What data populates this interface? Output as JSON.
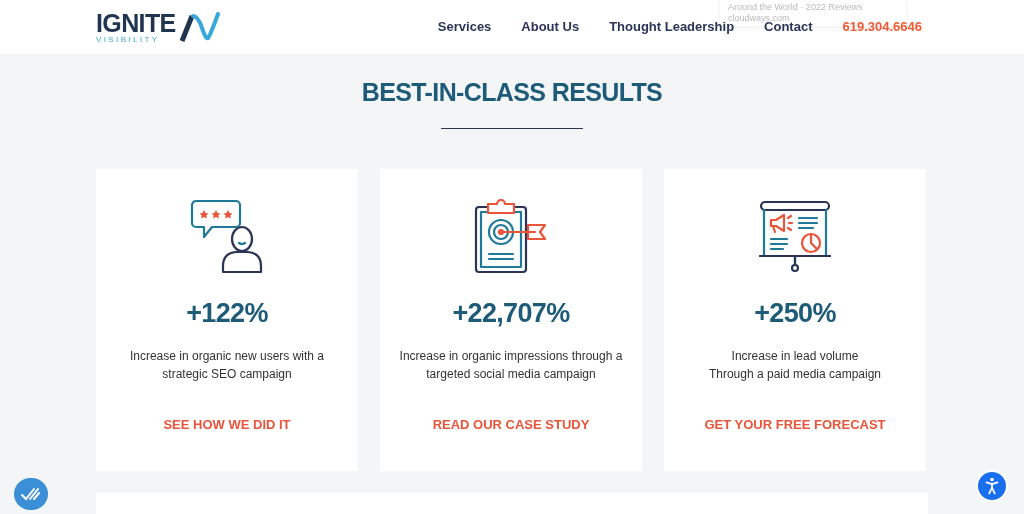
{
  "header": {
    "logo": {
      "word": "IGNITE",
      "subword": "VISIBILITY"
    },
    "nav": [
      {
        "label": "Services",
        "kind": "link"
      },
      {
        "label": "About Us",
        "kind": "link"
      },
      {
        "label": "Thought Leadership",
        "kind": "link"
      },
      {
        "label": "Contact",
        "kind": "link"
      },
      {
        "label": "619.304.6646",
        "kind": "phone"
      }
    ],
    "popup": {
      "title": "Around the World · 2022 Reviews",
      "source": "cloudways.com"
    }
  },
  "section": {
    "title": "BEST-IN-CLASS RESULTS",
    "cards": [
      {
        "stat": "+122%",
        "lines": [
          "Increase in organic new users with a strategic SEO campaign"
        ],
        "cta": "SEE HOW WE DID IT"
      },
      {
        "stat": "+22,707%",
        "lines": [
          "Increase in organic impressions through a targeted social media campaign"
        ],
        "cta": "READ OUR CASE STUDY"
      },
      {
        "stat": "+250%",
        "lines": [
          "Increase in lead volume",
          "Through a paid media campaign"
        ],
        "cta": "GET YOUR FREE FORECAST"
      }
    ]
  }
}
